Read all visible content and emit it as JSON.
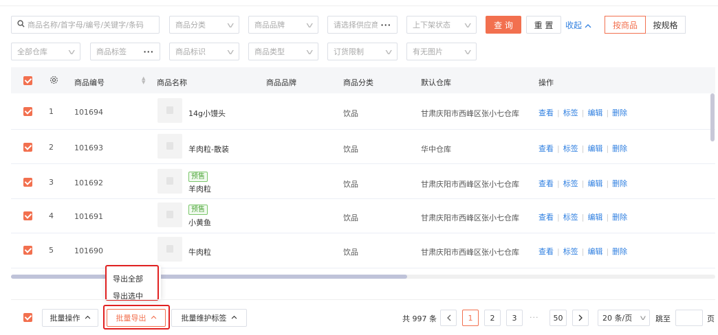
{
  "filters": {
    "search_placeholder": "商品名称/首字母/编号/关键字/条码",
    "category": "商品分类",
    "brand": "商品品牌",
    "supplier": "请选择供应商",
    "shelf_status": "上下架状态",
    "warehouse": "全部仓库",
    "goods_tag": "商品标签",
    "goods_mark": "商品标识",
    "goods_type": "商品类型",
    "order_limit": "订货限制",
    "has_image": "有无图片",
    "query_label": "查 询",
    "reset_label": "重 置",
    "collapse_label": "收起",
    "by_goods": "按商品",
    "by_spec": "按规格"
  },
  "table": {
    "columns": {
      "code": "商品编号",
      "name": "商品名称",
      "brand": "商品品牌",
      "category": "商品分类",
      "warehouse": "默认仓库",
      "ops": "操作"
    },
    "rows": [
      {
        "index": "1",
        "code": "101694",
        "name": "14g小馒头",
        "tag": "",
        "category": "饮品",
        "warehouse": "甘肃庆阳市西峰区张小七仓库"
      },
      {
        "index": "2",
        "code": "101693",
        "name": "羊肉粒-散装",
        "tag": "",
        "category": "饮品",
        "warehouse": "华中仓库"
      },
      {
        "index": "3",
        "code": "101692",
        "name": "羊肉粒",
        "tag": "预售",
        "category": "饮品",
        "warehouse": "甘肃庆阳市西峰区张小七仓库"
      },
      {
        "index": "4",
        "code": "101691",
        "name": "小黄鱼",
        "tag": "预售",
        "category": "饮品",
        "warehouse": "甘肃庆阳市西峰区张小七仓库"
      },
      {
        "index": "5",
        "code": "101690",
        "name": "牛肉粒",
        "tag": "",
        "category": "饮品",
        "warehouse": "甘肃庆阳市西峰区张小七仓库"
      }
    ],
    "ops": {
      "view": "查看",
      "tag": "标签",
      "edit": "编辑",
      "delete": "删除"
    }
  },
  "export_menu": {
    "all": "导出全部",
    "selected": "导出选中"
  },
  "footer": {
    "batch_ops": "批量操作",
    "batch_export": "批量导出",
    "batch_tags": "批量维护标签"
  },
  "pagination": {
    "total": "共 997 条",
    "pages": [
      "1",
      "2",
      "3"
    ],
    "ellipsis": "···",
    "last": "50",
    "page_size": "20 条/页",
    "jump_label": "跳至",
    "page_unit": "页"
  },
  "colors": {
    "accent": "#f2704f",
    "link": "#2f7fe0",
    "tag_green": "#52a83f",
    "highlight": "#e02020"
  }
}
